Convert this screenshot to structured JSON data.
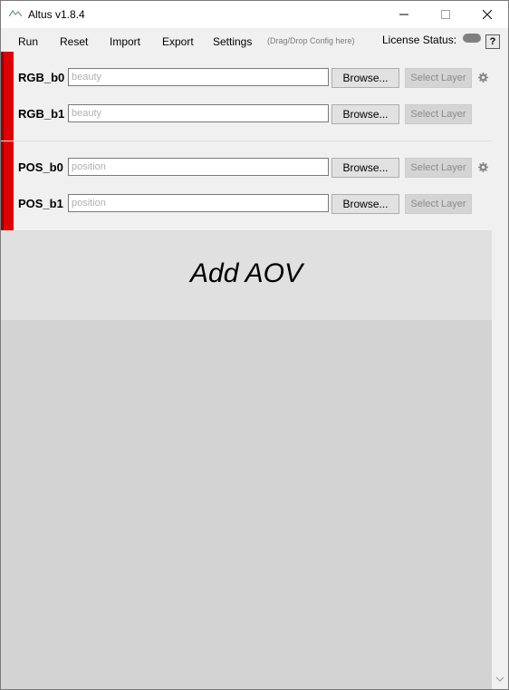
{
  "window": {
    "title": "Altus v1.8.4",
    "controls": [
      "minimize-icon",
      "maximize-icon",
      "close-icon"
    ]
  },
  "menu": {
    "items": [
      "Run",
      "Reset",
      "Import",
      "Export",
      "Settings"
    ],
    "hint": "(Drag/Drop Config here)",
    "license_label": "License Status:",
    "help_label": "?"
  },
  "groups": [
    {
      "rows": [
        {
          "label": "RGB_b0",
          "placeholder": "beauty",
          "browse": "Browse...",
          "select": "Select Layer"
        },
        {
          "label": "RGB_b1",
          "placeholder": "beauty",
          "browse": "Browse...",
          "select": "Select Layer"
        }
      ]
    },
    {
      "rows": [
        {
          "label": "POS_b0",
          "placeholder": "position",
          "browse": "Browse...",
          "select": "Select Layer"
        },
        {
          "label": "POS_b1",
          "placeholder": "position",
          "browse": "Browse...",
          "select": "Select Layer"
        }
      ]
    }
  ],
  "add_aov": {
    "label": "Add AOV"
  },
  "colors": {
    "accent_red": "#dd0000",
    "panel_bg": "#f0f0f0",
    "content_bg": "#d3d3d3",
    "add_aov_bg": "#e0e0e0"
  }
}
